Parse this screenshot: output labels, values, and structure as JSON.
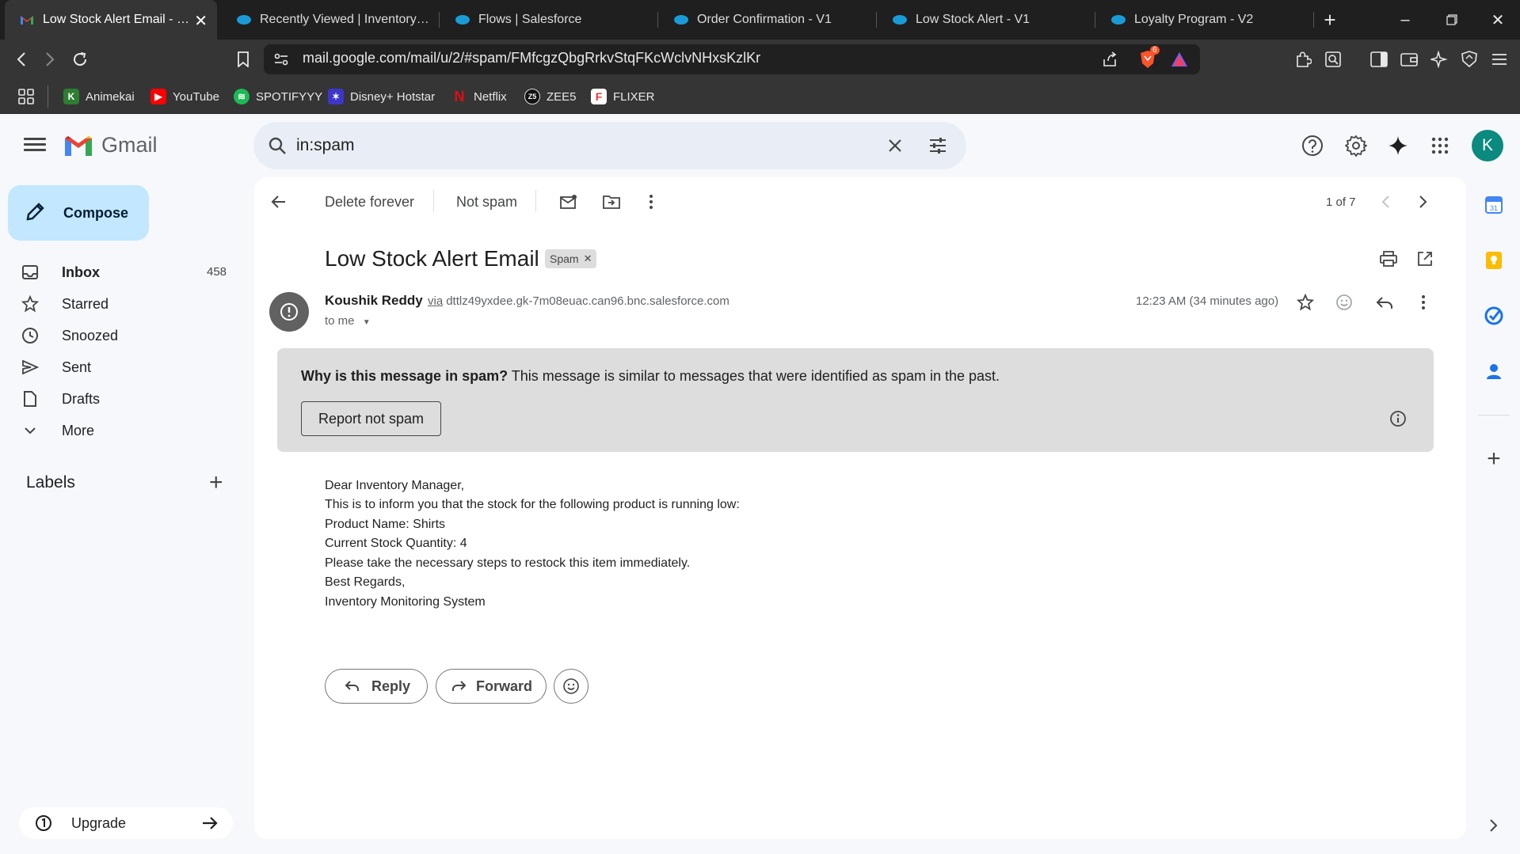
{
  "browser": {
    "tabs": [
      {
        "label": "Low Stock Alert Email - koxx",
        "favicon": "gmail-icon",
        "active": true
      },
      {
        "label": "Recently Viewed | Inventorys | Sa",
        "favicon": "salesforce-icon",
        "active": false
      },
      {
        "label": "Flows | Salesforce",
        "favicon": "salesforce-icon",
        "active": false
      },
      {
        "label": "Order Confirmation - V1",
        "favicon": "salesforce-icon",
        "active": false
      },
      {
        "label": "Low Stock Alert - V1",
        "favicon": "salesforce-icon",
        "active": false
      },
      {
        "label": "Loyalty Program - V2",
        "favicon": "salesforce-icon",
        "active": false
      }
    ],
    "url": "mail.google.com/mail/u/2/#spam/FMfcgzQbgRrkvStqFKcWclvNHxsKzlKr",
    "shield_badge": "6",
    "bookmarks": [
      {
        "label": "Animekai",
        "color": "#2e7d32"
      },
      {
        "label": "YouTube",
        "color": "#ff0000"
      },
      {
        "label": "SPOTIFYYY",
        "color": "#1db954"
      },
      {
        "label": "Disney+ Hotstar",
        "color": "#3d36c9"
      },
      {
        "label": "Netflix",
        "color": "#e50914"
      },
      {
        "label": "ZEE5",
        "color": "#222222"
      },
      {
        "label": "FLIXER",
        "color": "#e53935"
      }
    ]
  },
  "gmail": {
    "app_name": "Gmail",
    "search_query": "in:spam",
    "avatar_letter": "K",
    "compose_label": "Compose",
    "nav": [
      {
        "label": "Inbox",
        "count": "458",
        "icon": "inbox-icon"
      },
      {
        "label": "Starred",
        "count": "",
        "icon": "star-icon"
      },
      {
        "label": "Snoozed",
        "count": "",
        "icon": "clock-icon"
      },
      {
        "label": "Sent",
        "count": "",
        "icon": "send-icon"
      },
      {
        "label": "Drafts",
        "count": "",
        "icon": "draft-icon"
      },
      {
        "label": "More",
        "count": "",
        "icon": "chevron-down-icon"
      }
    ],
    "labels_title": "Labels",
    "upgrade_label": "Upgrade",
    "toolbar": {
      "delete_forever": "Delete forever",
      "not_spam": "Not spam",
      "pagination": "1 of 7"
    },
    "email": {
      "subject": "Low Stock Alert Email",
      "chip": "Spam",
      "sender_name": "Koushik Reddy",
      "via_label": "via",
      "via_domain": "dttlz49yxdee.gk-7m08euac.can96.bnc.salesforce.com",
      "to": "to me",
      "time": "12:23 AM (34 minutes ago)",
      "spam_warning_bold": "Why is this message in spam?",
      "spam_warning_text": "This message is similar to messages that were identified as spam in the past.",
      "report_not_spam": "Report not spam",
      "body": [
        "Dear Inventory Manager,",
        "This is to inform you that the stock for the following product is running low:",
        "Product Name: Shirts",
        "Current Stock Quantity: 4",
        "Please take the necessary steps to restock this item immediately.",
        "Best Regards,",
        "Inventory Monitoring System"
      ],
      "reply_label": "Reply",
      "forward_label": "Forward"
    }
  }
}
